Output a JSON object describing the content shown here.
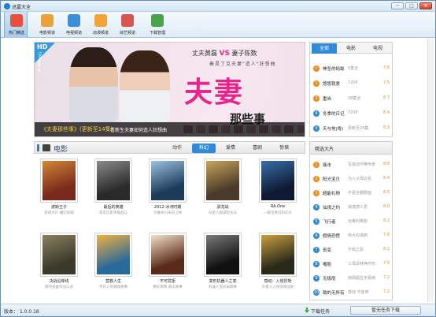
{
  "window": {
    "title": "迅雷大全",
    "min": "─",
    "max": "□",
    "close": "✕"
  },
  "toolbar": [
    {
      "label": "热门精选",
      "color": "#e94e3c",
      "active": true
    },
    {
      "label": "电影频道",
      "color": "#e8a33b"
    },
    {
      "label": "电视频道",
      "color": "#3c8fd6"
    },
    {
      "label": "动漫频道",
      "color": "#f2a43a"
    },
    {
      "label": "综艺频道",
      "color": "#d9534f"
    },
    {
      "label": "下载管理",
      "color": "#4aa34c"
    }
  ],
  "banner": {
    "badge": "HD",
    "badge_sub": "720P高清下载",
    "cast_a": "丈夫黄磊",
    "vs": "VS",
    "cast_b": "妻子陈数",
    "tag": "秦昊丁克夫妻\"造人\"狂想曲",
    "big": "夫妻",
    "big_sub": "那些事",
    "caption_title": "《夫妻那些事》(更新至14集)",
    "caption_desc": "看新生夫妻如何造人狂想曲"
  },
  "section": {
    "title": "电影",
    "tabs": [
      "动作",
      "科幻",
      "爱情",
      "喜剧",
      "惊悚"
    ],
    "active_tab": 1
  },
  "movies": [
    {
      "title": "波斯王子",
      "desc": "史诗大片 魔幻穿越",
      "c1": "#7a2a1a",
      "c2": "#d0863a"
    },
    {
      "title": "最后的英雄",
      "desc": "现实历史英雄战斗",
      "c1": "#2a2a2a",
      "c2": "#8a8a8a"
    },
    {
      "title": "2012:冰河时期",
      "desc": "灾难冰川末日上映",
      "c1": "#1c3a5a",
      "c2": "#9cc3df"
    },
    {
      "title": "驯龙战",
      "desc": "兄弟人类操控龙与",
      "c1": "#4a3a2a",
      "c2": "#c9a35a"
    },
    {
      "title": "RA.One",
      "desc": "一部宝莱坞科幻片",
      "c1": "#0e1a33",
      "c2": "#3a6ea8"
    },
    {
      "title": "决战沿岸线",
      "desc": "随时准备作战三武",
      "c1": "#3a3a2a",
      "c2": "#8a8060"
    },
    {
      "title": "营救人生",
      "desc": "平凡人的救赎故事",
      "c1": "#2a6a9a",
      "c2": "#f0b040"
    },
    {
      "title": "不可抗拒",
      "desc": "精彩惊悚 真实故事",
      "c1": "#5a2a1a",
      "c2": "#f2e0c8"
    },
    {
      "title": "变形机器人之变",
      "desc": "机器人变形再袭来",
      "c1": "#111111",
      "c2": "#7a7a7a"
    },
    {
      "title": "感动：入侵异地",
      "desc": "外星人入侵地球战争",
      "c1": "#2a2a1a",
      "c2": "#c9a040"
    }
  ],
  "tv": {
    "tabs": [
      "全部",
      "电影",
      "电视"
    ],
    "active": 0,
    "items": [
      {
        "num": "1",
        "title": "神圣的蚂蚁",
        "desc": "5集全",
        "score": "7.6"
      },
      {
        "num": "2",
        "title": "悠悠我爱",
        "desc": "720P",
        "score": "7.5"
      },
      {
        "num": "3",
        "title": "重岚",
        "desc": "38集全",
        "score": "8.7"
      },
      {
        "num": "4",
        "title": "冬季的日记",
        "desc": "720P",
        "score": "8.4"
      },
      {
        "num": "5",
        "title": "天与地(粤)",
        "desc": "更新至24集",
        "score": "8.3"
      }
    ]
  },
  "picks": {
    "title": "精选大片",
    "items": [
      {
        "num": "1",
        "title": "痛击",
        "desc": "写底动作带传奇",
        "score": "8.6"
      },
      {
        "num": "2",
        "title": "阳光宝贝",
        "desc": "为人父母必看",
        "score": "8.4"
      },
      {
        "num": "3",
        "title": "超能礼物",
        "desc": "不看全都剧面",
        "score": "8.5"
      },
      {
        "num": "4",
        "title": "仙境之约",
        "desc": "浪漫感人爱",
        "score": "8.0"
      },
      {
        "num": "5",
        "title": "飞行者",
        "desc": "全奥利奥斯",
        "score": "8.2"
      },
      {
        "num": "6",
        "title": "假情恐慌",
        "desc": "伟大的谎疯",
        "score": "7.6"
      },
      {
        "num": "7",
        "title": "丧变",
        "desc": "不知之恶",
        "score": "8.2"
      },
      {
        "num": "8",
        "title": "嘴脸",
        "desc": "三母武林神疗伤",
        "score": "7.5"
      },
      {
        "num": "9",
        "title": "无极雨",
        "desc": "雨网超显无极雨",
        "score": "7.2"
      },
      {
        "num": "10",
        "title": "致的无所有",
        "desc": "感动 不放弃",
        "score": "7.2"
      }
    ]
  },
  "status": {
    "version_label": "版本：",
    "version": "1.0.0.18",
    "download": "下载任务",
    "no_task": "暂无任务下载"
  }
}
